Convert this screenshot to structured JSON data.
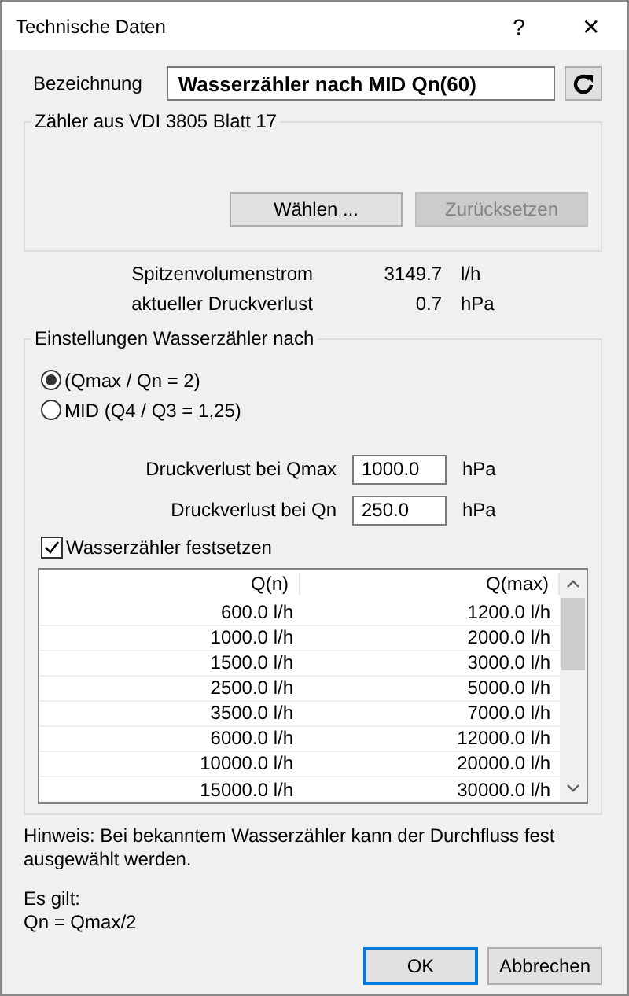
{
  "window": {
    "title": "Technische Daten",
    "help": "?",
    "close": "✕"
  },
  "designation": {
    "label": "Bezeichnung",
    "value": "Wasserzähler nach MID Qn(60)"
  },
  "vdi_group": {
    "title": "Zähler aus VDI 3805 Blatt 17",
    "buttons": [
      {
        "label": "Wählen ...",
        "disabled": false
      },
      {
        "label": "Zurücksetzen",
        "disabled": true
      }
    ]
  },
  "readings": [
    {
      "label": "Spitzenvolumenstrom",
      "value": "3149.7",
      "unit": "l/h"
    },
    {
      "label": "aktueller Druckverlust",
      "value": "0.7",
      "unit": "hPa"
    }
  ],
  "settings": {
    "title": "Einstellungen Wasserzähler nach",
    "options": [
      {
        "label": "(Qmax / Qn = 2)",
        "selected": true
      },
      {
        "label": "MID (Q4 / Q3 = 1,25)",
        "selected": false
      }
    ],
    "fields": [
      {
        "label": "Druckverlust bei Qmax",
        "value": "1000.0",
        "unit": "hPa"
      },
      {
        "label": "Druckverlust bei Qn",
        "value": "250.0",
        "unit": "hPa"
      }
    ],
    "fix": {
      "label": "Wasserzähler festsetzen",
      "checked": true
    },
    "table": {
      "columns": [
        "Q(n)",
        "Q(max)"
      ],
      "rows": [
        [
          "600.0 l/h",
          "1200.0 l/h"
        ],
        [
          "1000.0 l/h",
          "2000.0 l/h"
        ],
        [
          "1500.0 l/h",
          "3000.0 l/h"
        ],
        [
          "2500.0 l/h",
          "5000.0 l/h"
        ],
        [
          "3500.0 l/h",
          "7000.0 l/h"
        ],
        [
          "6000.0 l/h",
          "12000.0 l/h"
        ],
        [
          "10000.0 l/h",
          "20000.0 l/h"
        ],
        [
          "15000.0 l/h",
          "30000.0 l/h"
        ]
      ]
    }
  },
  "hint": [
    "Hinweis: Bei bekanntem Wasserzähler kann der Durchfluss fest ausgewählt werden.",
    "Es gilt:",
    "Qn = Qmax/2"
  ],
  "buttons": [
    {
      "label": "OK",
      "default": true
    },
    {
      "label": "Abbrechen",
      "default": false
    }
  ]
}
